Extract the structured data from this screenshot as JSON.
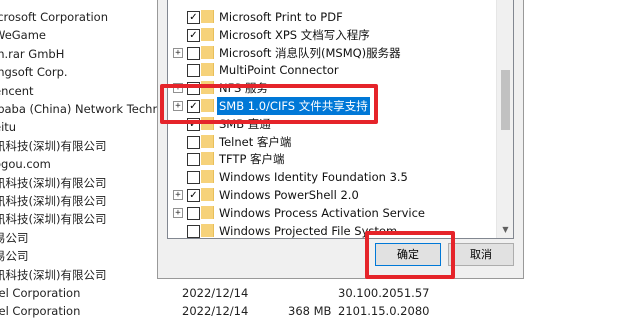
{
  "background_list": {
    "rows": [
      {
        "name": "icrosoft Corporation",
        "date": "",
        "size": "",
        "version": ""
      },
      {
        "name": "WeGame",
        "date": "",
        "size": "",
        "version": ""
      },
      {
        "name": "in.rar GmbH",
        "date": "",
        "size": "",
        "version": ""
      },
      {
        "name": "ingsoft Corp.",
        "date": "",
        "size": "",
        "version": ""
      },
      {
        "name": "encent",
        "date": "",
        "size": "",
        "version": ""
      },
      {
        "name": "ibaba (China) Network Techno",
        "date": "",
        "size": "",
        "version": ""
      },
      {
        "name": "eitu",
        "date": "",
        "size": "",
        "version": ""
      },
      {
        "name": "讯科技(深圳)有限公司",
        "date": "",
        "size": "",
        "version": ""
      },
      {
        "name": "ogou.com",
        "date": "",
        "size": "",
        "version": ""
      },
      {
        "name": "讯科技(深圳)有限公司",
        "date": "",
        "size": "",
        "version": ""
      },
      {
        "name": "讯科技(深圳)有限公司",
        "date": "",
        "size": "",
        "version": ""
      },
      {
        "name": "讯科技(深圳)有限公司",
        "date": "",
        "size": "",
        "version": ""
      },
      {
        "name": "易公司",
        "date": "",
        "size": "",
        "version": ""
      },
      {
        "name": "易公司",
        "date": "",
        "size": "",
        "version": ""
      },
      {
        "name": "讯科技(深圳)有限公司",
        "date": "",
        "size": "",
        "version": ""
      },
      {
        "name": "tel Corporation",
        "date": "2022/12/14",
        "size": "",
        "version": "30.100.2051.57"
      },
      {
        "name": "tel Corporation",
        "date": "2022/12/14",
        "size": "368 MB",
        "version": "2101.15.0.2080"
      }
    ]
  },
  "features_tree": {
    "items": [
      {
        "label": "Microsoft Print to PDF",
        "checked": true,
        "expandable": false,
        "selected": false
      },
      {
        "label": "Microsoft XPS 文档写入程序",
        "checked": true,
        "expandable": false,
        "selected": false
      },
      {
        "label": "Microsoft 消息队列(MSMQ)服务器",
        "checked": false,
        "expandable": true,
        "selected": false
      },
      {
        "label": "MultiPoint Connector",
        "checked": false,
        "expandable": false,
        "selected": false
      },
      {
        "label": "NFS 服务",
        "checked": false,
        "expandable": true,
        "selected": false
      },
      {
        "label": "SMB 1.0/CIFS 文件共享支持",
        "checked": true,
        "expandable": true,
        "selected": true
      },
      {
        "label": "SMB 直通",
        "checked": true,
        "expandable": false,
        "selected": false
      },
      {
        "label": "Telnet 客户端",
        "checked": false,
        "expandable": false,
        "selected": false
      },
      {
        "label": "TFTP 客户端",
        "checked": false,
        "expandable": false,
        "selected": false
      },
      {
        "label": "Windows Identity Foundation 3.5",
        "checked": false,
        "expandable": false,
        "selected": false
      },
      {
        "label": "Windows PowerShell 2.0",
        "checked": true,
        "expandable": true,
        "selected": false
      },
      {
        "label": "Windows Process Activation Service",
        "checked": false,
        "expandable": true,
        "selected": false
      },
      {
        "label": "Windows Projected File System",
        "checked": false,
        "expandable": false,
        "selected": false
      }
    ]
  },
  "buttons": {
    "ok_label": "确定",
    "cancel_label": "取消"
  },
  "icons": {
    "expander": "plus-icon",
    "folder": "folder-icon",
    "check": "checkmark-icon",
    "scroll_down": "chevron-down-icon"
  },
  "colors": {
    "selection": "#0078d7",
    "highlight_annotation": "#e5242a",
    "folder": "#f6d27a"
  }
}
